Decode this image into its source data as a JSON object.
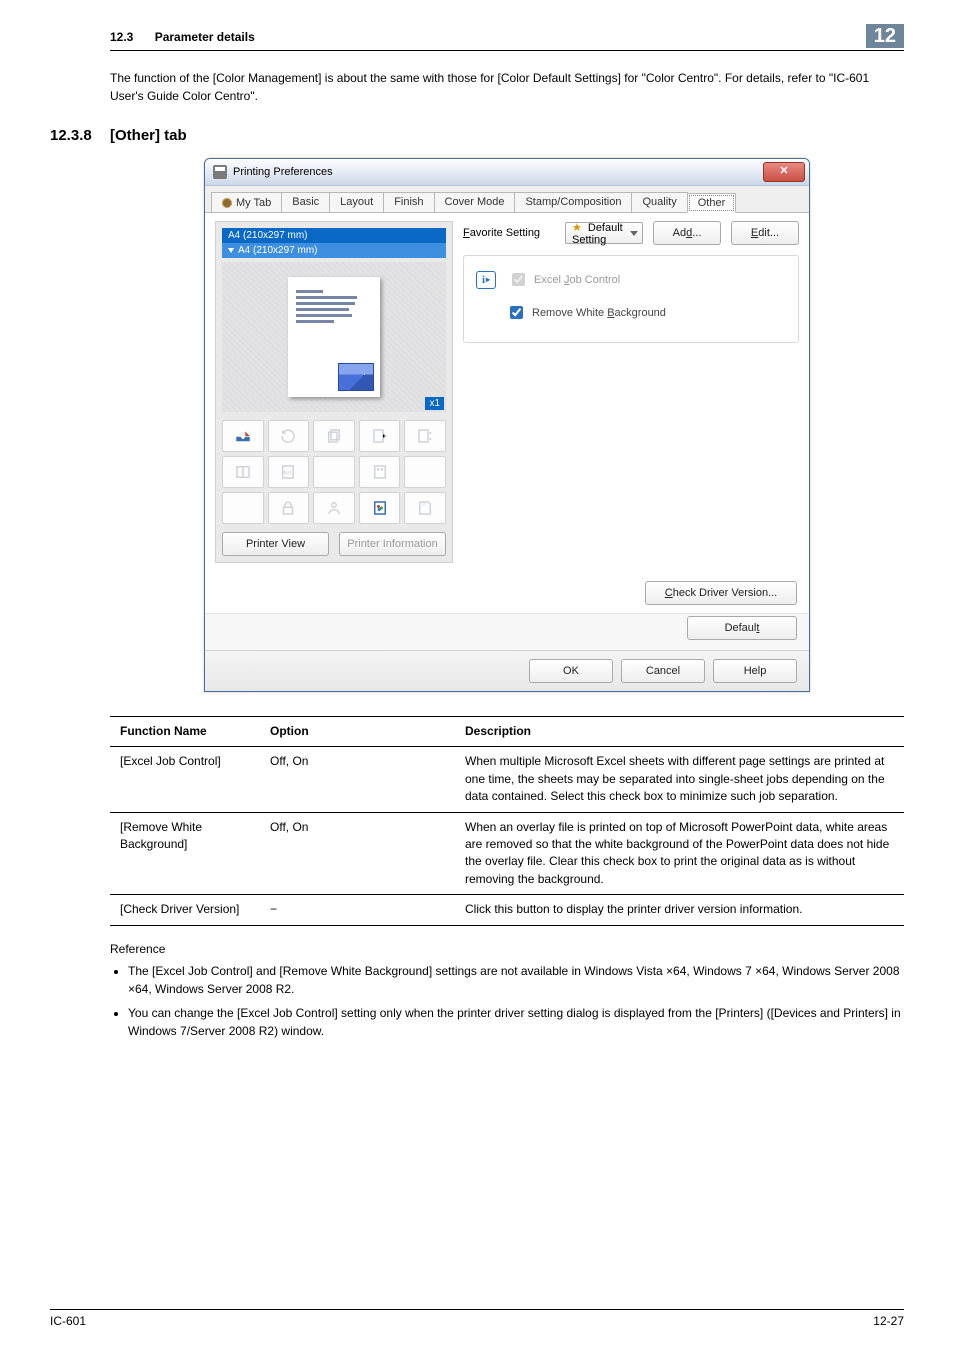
{
  "header": {
    "section_number": "12.3",
    "section_title": "Parameter details",
    "chapter_badge": "12"
  },
  "intro_paragraph": "The function of the [Color Management] is about the same with those for [Color Default Settings] for \"Color Centro\". For details, refer to \"IC-601 User's Guide Color Centro\".",
  "heading": {
    "number": "12.3.8",
    "title": "[Other] tab"
  },
  "screenshot": {
    "window_title": "Printing Preferences",
    "close_glyph": "✕",
    "tabs": [
      "My Tab",
      "Basic",
      "Layout",
      "Finish",
      "Cover Mode",
      "Stamp/Composition",
      "Quality",
      "Other"
    ],
    "active_tab_index": 7,
    "preview": {
      "size_a": "A4 (210x297 mm)",
      "size_b": "A4 (210x297 mm)",
      "x1": "x1",
      "printer_view_btn": "Printer View",
      "printer_info_btn": "Printer Information"
    },
    "favorite": {
      "label_pre": "F",
      "label_rest": "avorite Setting",
      "selected": "Default Setting",
      "add_btn_ul": "d",
      "add_btn_rest": "Ad",
      "add_btn_suffix": "...",
      "edit_btn_ul": "E",
      "edit_btn_rest": "dit..."
    },
    "options": {
      "excel_pre": "Excel ",
      "excel_ul": "J",
      "excel_rest": "ob Control",
      "remove_pre": "Remove White ",
      "remove_ul": "B",
      "remove_rest": "ackground"
    },
    "driver_btn_ul": "C",
    "driver_btn_rest": "heck Driver Version...",
    "default_btn_rest": "Defaul",
    "default_btn_ul": "t",
    "bottom": {
      "ok": "OK",
      "cancel": "Cancel",
      "help": "Help"
    }
  },
  "table": {
    "headers": [
      "Function Name",
      "Option",
      "Description"
    ],
    "rows": [
      {
        "name": "[Excel Job Control]",
        "option": "Off, On",
        "desc": "When multiple Microsoft Excel sheets with different page settings are printed at one time, the sheets may be separated into single-sheet jobs depending on the data contained. Select this check box to minimize such job separation."
      },
      {
        "name": "[Remove White Background]",
        "option": "Off, On",
        "desc": "When an overlay file is printed on top of Microsoft PowerPoint data, white areas are removed so that the white background of the PowerPoint data does not hide the overlay file. Clear this check box to print the original data as is without removing the background."
      },
      {
        "name": "[Check Driver Version]",
        "option": "−",
        "desc": "Click this button to display the printer driver version information."
      }
    ]
  },
  "reference": {
    "label": "Reference",
    "bullets": [
      "The [Excel Job Control] and [Remove White Background] settings are not available in  Windows Vista ×64,  Windows 7 ×64, Windows Server 2008 ×64, Windows Server 2008 R2.",
      "You can change the [Excel Job Control] setting only when the printer driver setting dialog is displayed from the [Printers] ([Devices and Printers] in Windows 7/Server 2008 R2) window."
    ]
  },
  "footer": {
    "left": "IC-601",
    "right": "12-27"
  }
}
